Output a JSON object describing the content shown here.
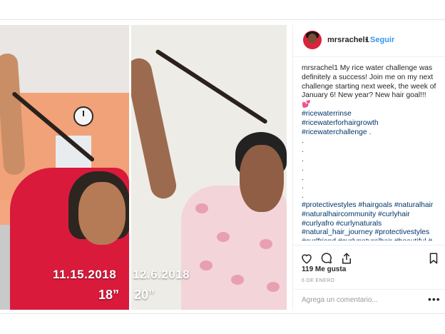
{
  "post": {
    "username": "mrsrachel1",
    "separator": "•",
    "follow_label": "Seguir",
    "left_date": "11.15.2018",
    "left_length": "18”",
    "right_date": "12.6.2018",
    "right_length": "20”"
  },
  "caption": {
    "user": "mrsrachel1",
    "text": " My rice water challenge was definitely a success! Join me on my next challenge starting next week, the week of January 6! New year? New hair goal!!!",
    "emoji": "💕",
    "hashtags_top": [
      "#ricewaterrinse",
      "#ricewaterforhairgrowth",
      "#ricewaterchallenge ."
    ],
    "dots": [
      ".",
      ".",
      ".",
      ".",
      ".",
      ".",
      "."
    ],
    "hashtags_bottom": "#protectivestyles #hairgoals #naturalhair #naturalhaircommunity #curlyhair #curlyafro #curlynaturals #natural_hair_journey #protectivestyles #curlfriend #curlynaturalhair #beautiful #...."
  },
  "actions": {
    "like_icon": "heart-icon",
    "comment_icon": "comment-icon",
    "share_icon": "share-icon",
    "save_icon": "bookmark-icon"
  },
  "likes": "119 Me gusta",
  "date": "6 DE ENERO",
  "comment": {
    "placeholder": "Agrega un comentario...",
    "more": "•••"
  },
  "colors": {
    "link": "#3897f0",
    "hashtag": "#003569"
  }
}
